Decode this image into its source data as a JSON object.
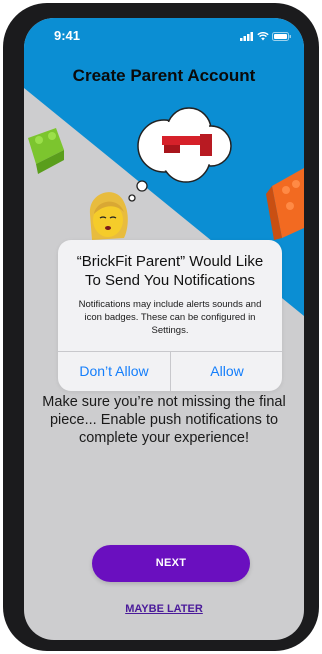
{
  "status_bar": {
    "time": "9:41",
    "icons": [
      "signal-icon",
      "wifi-icon",
      "battery-icon"
    ]
  },
  "screen": {
    "title": "Create Parent Account",
    "prompt": "Make sure you’re not missing the final piece... Enable push notifications to complete your experience!",
    "next_label": "NEXT",
    "maybe_later_label": "MAYBE LATER"
  },
  "alert": {
    "title": "“BrickFit Parent” Would Like To Send You Notifications",
    "message": "Notifications may include alerts sounds and icon badges. These can be configured in Settings.",
    "deny_label": "Don’t Allow",
    "allow_label": "Allow"
  },
  "colors": {
    "header_blue": "#0b8ed3",
    "screen_gray": "#cdcdcf",
    "next_purple": "#6a0fbf",
    "link_purple": "#4a1a9a",
    "alert_blue": "#147efb",
    "brick_green": "#7cc52e",
    "brick_orange": "#f26a21",
    "brick_red": "#d6212a"
  }
}
